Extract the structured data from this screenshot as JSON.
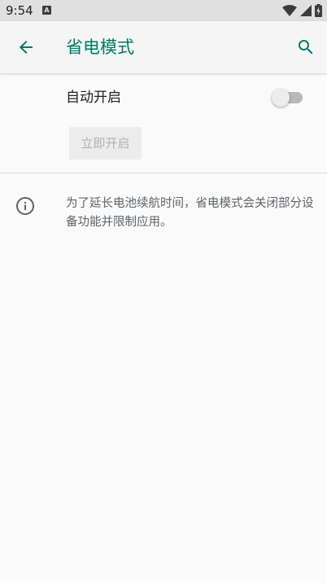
{
  "status_bar": {
    "time": "9:54",
    "notification_badge": "A",
    "icons": [
      "wifi-icon",
      "signal-icon",
      "battery-charging-icon"
    ]
  },
  "app_bar": {
    "title": "省电模式",
    "back_icon": "arrow-left-icon",
    "search_icon": "search-icon",
    "accent_color": "#00796b"
  },
  "settings": {
    "auto_enable_label": "自动开启",
    "auto_enable_on": false,
    "turn_on_now_label": "立即开启",
    "turn_on_now_enabled": false
  },
  "info": {
    "icon": "info-icon",
    "text": "为了延长电池续航时间，省电模式会关闭部分设备功能并限制应用。"
  }
}
